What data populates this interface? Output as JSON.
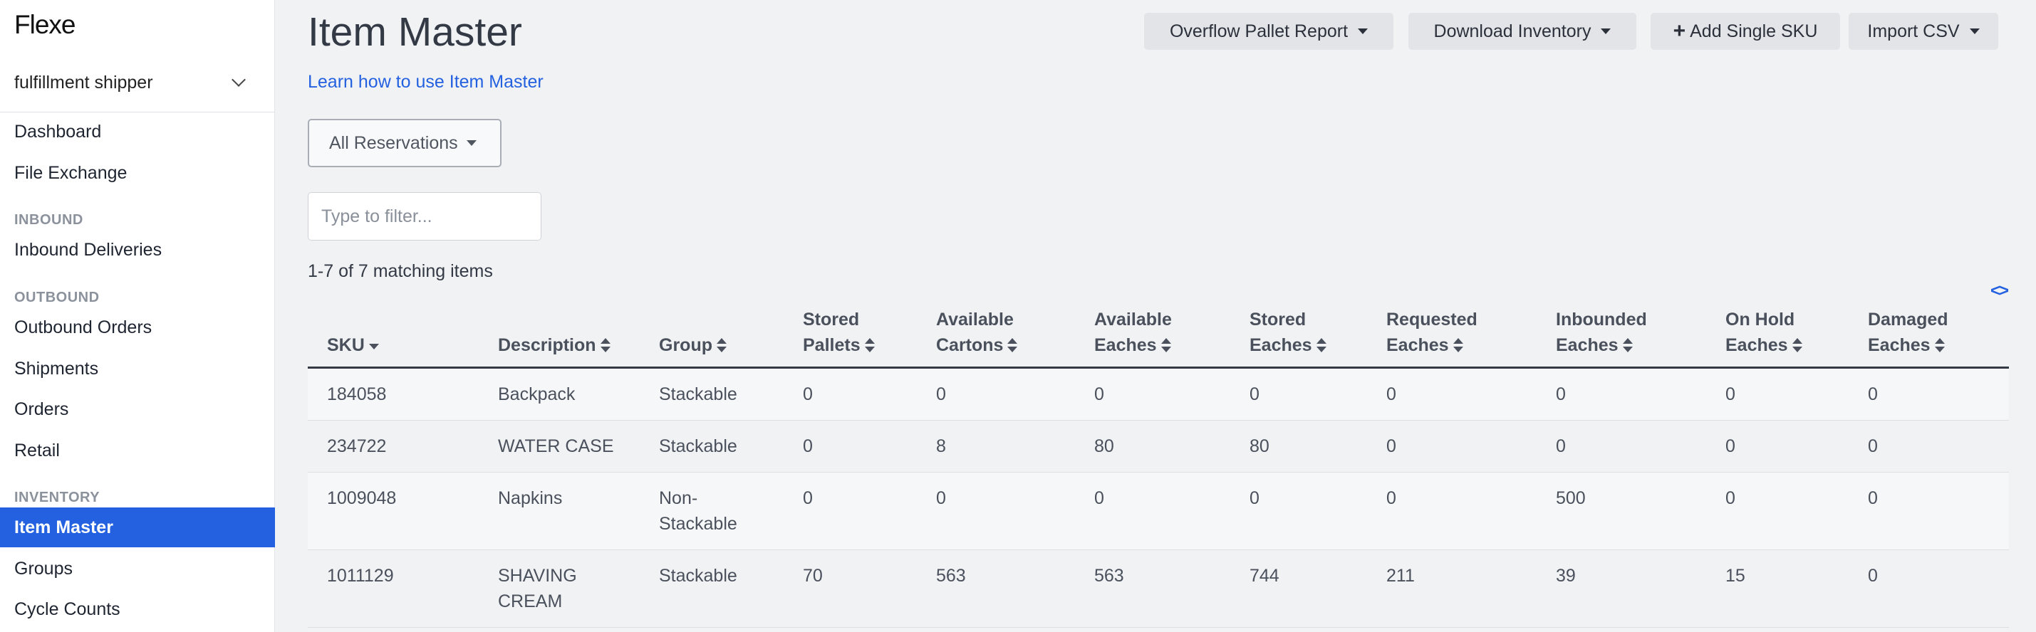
{
  "app": {
    "logo": "Flexe",
    "account": "fulfillment shipper"
  },
  "sidebar": {
    "items_top": [
      {
        "label": "Dashboard"
      },
      {
        "label": "File Exchange"
      }
    ],
    "sections": [
      {
        "heading": "INBOUND",
        "items": [
          {
            "label": "Inbound Deliveries"
          }
        ]
      },
      {
        "heading": "OUTBOUND",
        "items": [
          {
            "label": "Outbound Orders"
          },
          {
            "label": "Shipments"
          },
          {
            "label": "Orders"
          },
          {
            "label": "Retail"
          }
        ]
      },
      {
        "heading": "INVENTORY",
        "items": [
          {
            "label": "Item Master",
            "active": true
          },
          {
            "label": "Groups"
          },
          {
            "label": "Cycle Counts"
          }
        ]
      }
    ]
  },
  "header": {
    "title": "Item Master",
    "learn_link": "Learn how to use Item Master",
    "buttons": {
      "overflow_report": "Overflow Pallet Report",
      "download_inventory": "Download Inventory",
      "add_sku": "Add Single SKU",
      "import_csv": "Import CSV"
    }
  },
  "filters": {
    "reservations": "All Reservations",
    "filter_placeholder": "Type to filter...",
    "match_count": "1-7 of 7 matching items",
    "code_toggle": "<>"
  },
  "table": {
    "columns": [
      {
        "key": "sku",
        "line1": "",
        "line2": "SKU"
      },
      {
        "key": "description",
        "line1": "",
        "line2": "Description"
      },
      {
        "key": "group",
        "line1": "",
        "line2": "Group"
      },
      {
        "key": "stored_pallets",
        "line1": "Stored",
        "line2": "Pallets"
      },
      {
        "key": "available_cartons",
        "line1": "Available",
        "line2": "Cartons"
      },
      {
        "key": "available_eaches",
        "line1": "Available",
        "line2": "Eaches"
      },
      {
        "key": "stored_eaches",
        "line1": "Stored",
        "line2": "Eaches"
      },
      {
        "key": "requested_eaches",
        "line1": "Requested",
        "line2": "Eaches"
      },
      {
        "key": "inbounded_eaches",
        "line1": "Inbounded",
        "line2": "Eaches"
      },
      {
        "key": "on_hold_eaches",
        "line1": "On Hold",
        "line2": "Eaches"
      },
      {
        "key": "damaged_eaches",
        "line1": "Damaged",
        "line2": "Eaches"
      }
    ],
    "rows": [
      {
        "sku": "184058",
        "description": "Backpack",
        "group": "Stackable",
        "stored_pallets": "0",
        "available_cartons": "0",
        "available_eaches": "0",
        "stored_eaches": "0",
        "requested_eaches": "0",
        "inbounded_eaches": "0",
        "on_hold_eaches": "0",
        "damaged_eaches": "0"
      },
      {
        "sku": "234722",
        "description": "WATER CASE",
        "group": "Stackable",
        "stored_pallets": "0",
        "available_cartons": "8",
        "available_eaches": "80",
        "stored_eaches": "80",
        "requested_eaches": "0",
        "inbounded_eaches": "0",
        "on_hold_eaches": "0",
        "damaged_eaches": "0"
      },
      {
        "sku": "1009048",
        "description": "Napkins",
        "group": "Non-\nStackable",
        "stored_pallets": "0",
        "available_cartons": "0",
        "available_eaches": "0",
        "stored_eaches": "0",
        "requested_eaches": "0",
        "inbounded_eaches": "500",
        "on_hold_eaches": "0",
        "damaged_eaches": "0"
      },
      {
        "sku": "1011129",
        "description": "SHAVING\nCREAM",
        "group": "Stackable",
        "stored_pallets": "70",
        "available_cartons": "563",
        "available_eaches": "563",
        "stored_eaches": "744",
        "requested_eaches": "211",
        "inbounded_eaches": "39",
        "on_hold_eaches": "15",
        "damaged_eaches": "0"
      }
    ]
  },
  "colors": {
    "accent": "#2461e0",
    "page_bg": "#f1f2f4",
    "text": "#333a45"
  }
}
